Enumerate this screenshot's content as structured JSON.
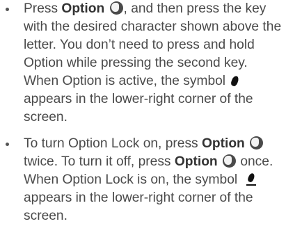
{
  "bullets": [
    {
      "parts": {
        "p1": "Press ",
        "key1": "Option",
        "p2": ", and then press the key with the desired character shown above the letter. You don’t need to press and hold Option while pressing the second key. When Option is active, the symbol ",
        "p3": " appears in the lower-right corner of the screen."
      }
    },
    {
      "parts": {
        "p1": "To turn Option Lock on, press ",
        "key1": "Option",
        "p2": " twice. To turn it off, press ",
        "key2": "Option",
        "p3": " once. When Option Lock is on, the symbol ",
        "p4": " appears in the lower-right corner of the screen."
      }
    }
  ],
  "icons": {
    "option_key": "option-key-icon",
    "option_active": "option-active-symbol",
    "option_lock": "option-lock-symbol"
  },
  "colors": {
    "text": "#4a4a4a",
    "key_button": "#4a4a4a",
    "symbol": "#111111"
  }
}
